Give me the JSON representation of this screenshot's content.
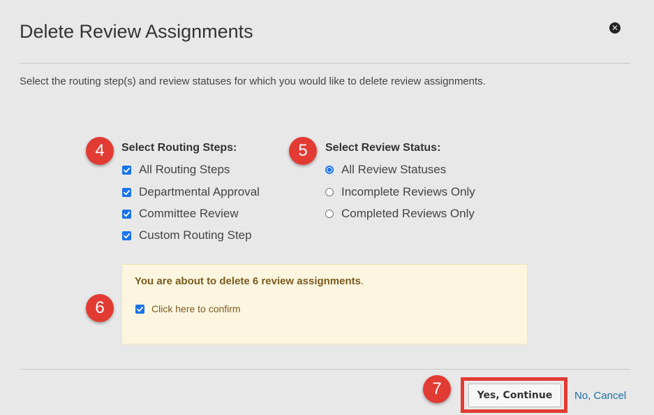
{
  "dialog": {
    "title": "Delete Review Assignments",
    "intro": "Select the routing step(s) and review statuses for which you would like to delete review assignments."
  },
  "routing_steps": {
    "heading": "Select Routing Steps:",
    "items": [
      {
        "label": "All Routing Steps",
        "checked": true
      },
      {
        "label": "Departmental Approval",
        "checked": true
      },
      {
        "label": "Committee Review",
        "checked": true
      },
      {
        "label": "Custom Routing Step",
        "checked": true
      }
    ]
  },
  "review_status": {
    "heading": "Select Review Status:",
    "options": [
      {
        "label": "All Review Statuses",
        "selected": true
      },
      {
        "label": "Incomplete Reviews Only",
        "selected": false
      },
      {
        "label": "Completed Reviews Only",
        "selected": false
      }
    ]
  },
  "confirm": {
    "message_bold": "You are about to delete 6 review assignments",
    "message_tail": ".",
    "checkbox_label": "Click here to confirm",
    "checked": true
  },
  "footer": {
    "continue_label": "Yes, Continue",
    "cancel_label": "No, Cancel"
  },
  "callouts": {
    "routing": "4",
    "status": "5",
    "confirm": "6",
    "continue": "7"
  },
  "colors": {
    "accent": "#1a73e8",
    "callout": "#e23b33",
    "link": "#1c6fa5",
    "notice_bg": "#fcf6e0"
  },
  "icons": {
    "close": "close-circle-icon",
    "checkbox": "checkmark-icon"
  }
}
